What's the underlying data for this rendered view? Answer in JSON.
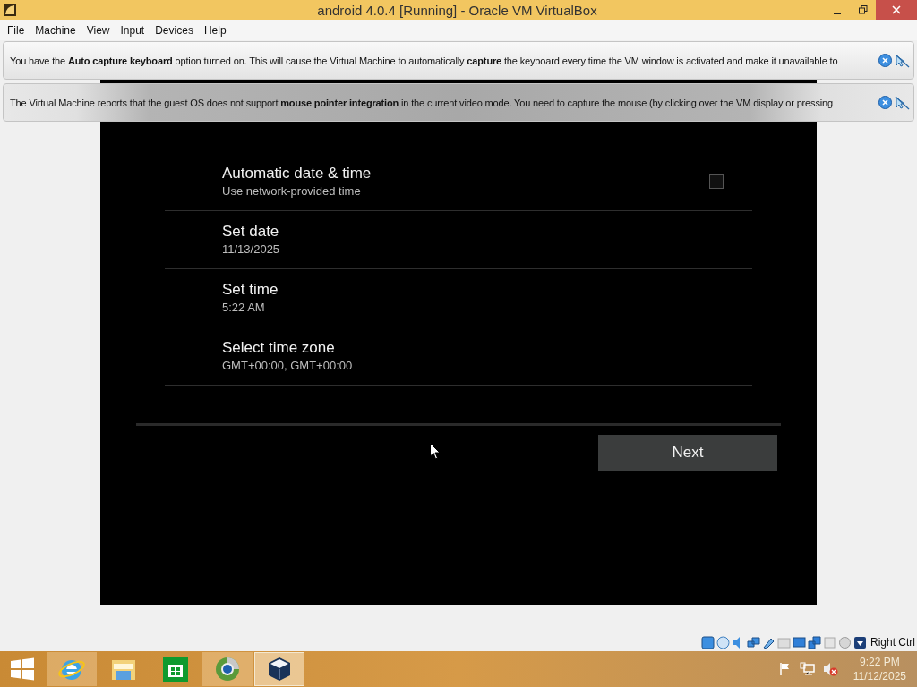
{
  "window": {
    "title": "android 4.0.4 [Running] - Oracle VM VirtualBox"
  },
  "menu": [
    "File",
    "Machine",
    "View",
    "Input",
    "Devices",
    "Help"
  ],
  "notifications": [
    {
      "text": "You have the **Auto capture keyboard** option turned on. This will cause the Virtual Machine to automatically **capture** the keyboard every time the VM window is activated and make it unavailable to"
    },
    {
      "text": "The Virtual Machine reports that the guest OS does not support **mouse pointer integration** in the current video mode. You need to capture the mouse (by clicking over the VM display or pressing"
    }
  ],
  "settings": [
    {
      "kind": "checkbox",
      "title": "Automatic date & time",
      "summary": "Use network-provided time",
      "checked": false
    },
    {
      "kind": "plain",
      "title": "Set date",
      "summary": "11/13/2025"
    },
    {
      "kind": "plain",
      "title": "Set time",
      "summary": "5:22 AM"
    },
    {
      "kind": "plain",
      "title": "Select time zone",
      "summary": "GMT+00:00, GMT+00:00"
    }
  ],
  "next_button": "Next",
  "status_bar": {
    "host_key": "Right Ctrl"
  },
  "taskbar": {
    "apps": [
      {
        "kind": "ie",
        "running": true,
        "selected": false
      },
      {
        "kind": "explorer",
        "running": false,
        "selected": false
      },
      {
        "kind": "store",
        "running": false,
        "selected": false
      },
      {
        "kind": "browser",
        "running": true,
        "selected": false
      },
      {
        "kind": "virtualbox",
        "running": true,
        "selected": true
      }
    ],
    "time": "9:22 PM",
    "date": "11/12/2025"
  }
}
